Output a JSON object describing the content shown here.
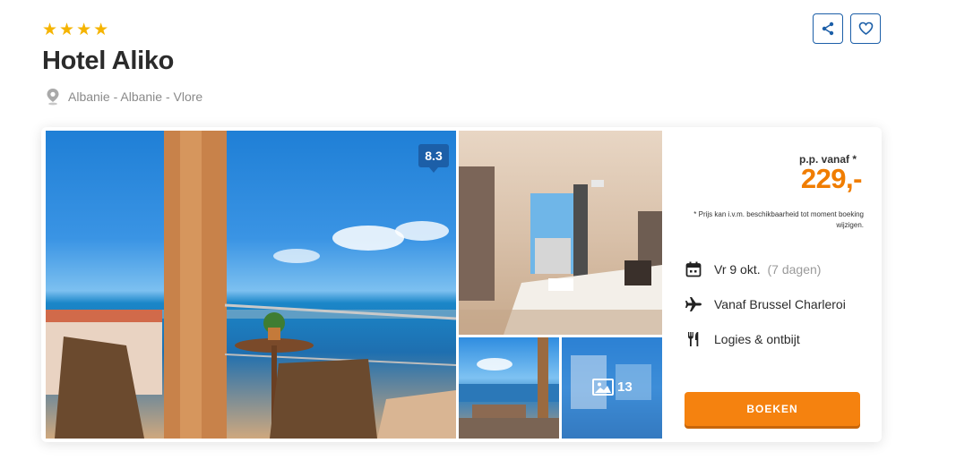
{
  "hotel": {
    "stars": 4,
    "star_glyph": "★",
    "name": "Hotel Aliko",
    "location": "Albanie - Albanie - Vlore"
  },
  "actions": {
    "share_icon": "share-icon",
    "favorite_icon": "heart-icon"
  },
  "gallery": {
    "rating": "8.3",
    "more_photos_count": "13"
  },
  "pricing": {
    "label": "p.p. vanaf *",
    "price": "229,-",
    "note": "* Prijs kan i.v.m. beschikbaarheid tot moment boeking wijzigen."
  },
  "details": {
    "date": "Vr 9 okt.",
    "duration": "(7 dagen)",
    "departure": "Vanaf Brussel Charleroi",
    "board": "Logies & ontbijt"
  },
  "cta": {
    "book_label": "BOEKEN"
  },
  "colors": {
    "accent_blue": "#1c5fa8",
    "price_orange": "#f07d00",
    "button_orange": "#f5820f",
    "star_yellow": "#f5b400"
  }
}
